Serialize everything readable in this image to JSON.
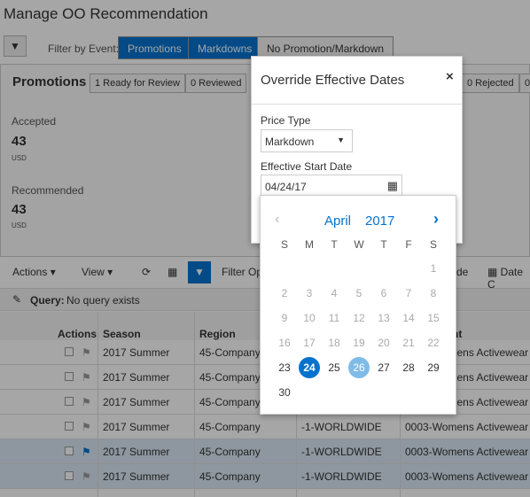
{
  "title": "Manage OO Recommendation",
  "filter": {
    "label": "Filter by Event:",
    "segments": [
      "Promotions",
      "Markdowns",
      "No Promotion/Markdown"
    ]
  },
  "panel": {
    "heading": "Promotions",
    "pills": [
      "1 Ready for Review",
      "0 Reviewed",
      "0 Rejected",
      "0"
    ],
    "accepted_label": "Accepted",
    "accepted_value": "43",
    "accepted_unit": "USD",
    "recommended_label": "Recommended",
    "recommended_value": "43",
    "recommended_unit": "USD"
  },
  "toolbar": {
    "actions": "Actions",
    "view": "View",
    "filter_options": "Filter Opt",
    "right1": "de",
    "date": "Date C"
  },
  "query": {
    "label": "Query:",
    "value": "No query exists"
  },
  "table": {
    "headers": [
      "Actions",
      "Season",
      "Region",
      "",
      "nt"
    ],
    "rows": [
      {
        "season": "2017 Summer",
        "region": "45-Company",
        "location": "",
        "dept": "0003-Womens Activewear",
        "selected": false
      },
      {
        "season": "2017 Summer",
        "region": "45-Company",
        "location": "",
        "dept": "0003-Womens Activewear",
        "selected": false
      },
      {
        "season": "2017 Summer",
        "region": "45-Company",
        "location": "",
        "dept": "0003-Womens Activewear",
        "selected": false
      },
      {
        "season": "2017 Summer",
        "region": "45-Company",
        "location": "-1-WORLDWIDE",
        "dept": "0003-Womens Activewear",
        "selected": false
      },
      {
        "season": "2017 Summer",
        "region": "45-Company",
        "location": "-1-WORLDWIDE",
        "dept": "0003-Womens Activewear",
        "selected": true
      },
      {
        "season": "2017 Summer",
        "region": "45-Company",
        "location": "-1-WORLDWIDE",
        "dept": "0003-Womens Activewear",
        "selected": true
      }
    ]
  },
  "dialog": {
    "title": "Override Effective Dates",
    "close": "×",
    "price_type_label": "Price Type",
    "price_type_value": "Markdown",
    "start_label": "Effective Start Date",
    "start_value": "04/24/17"
  },
  "calendar": {
    "month": "April",
    "year": "2017",
    "weekdays": [
      "S",
      "M",
      "T",
      "W",
      "T",
      "F",
      "S"
    ],
    "selected_day": 24,
    "hover_day": 26,
    "first_weekday": 6,
    "days_in_month": 30,
    "disabled_before": 23,
    "accent": "#0572ce",
    "hover_color": "#7fbbe6"
  }
}
